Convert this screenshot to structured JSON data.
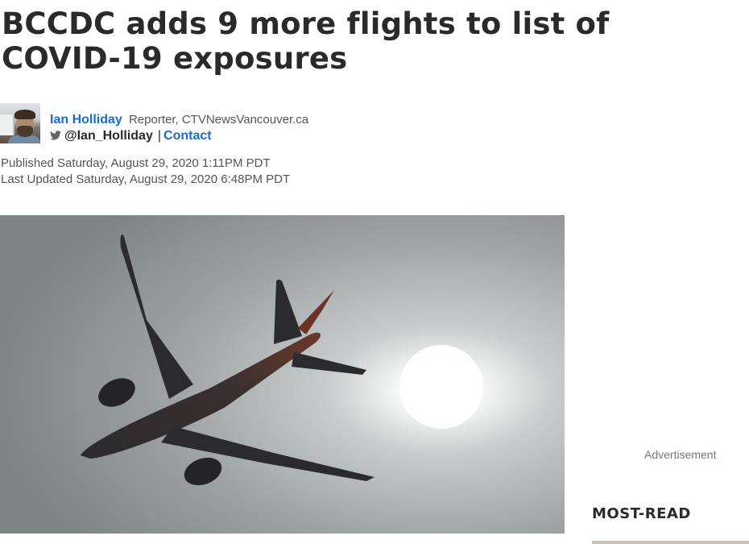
{
  "article": {
    "headline": "BCCDC adds 9 more flights to list of COVID-19 exposures",
    "author": {
      "name": "Ian Holliday",
      "role": "Reporter, CTVNewsVancouver.ca",
      "twitter_handle": "@Ian_Holliday",
      "separator": "|",
      "contact_label": "Contact",
      "avatar_icon": "author-photo"
    },
    "published": "Published Saturday, August 29, 2020 1:11PM PDT",
    "updated": "Last Updated Saturday, August 29, 2020 6:48PM PDT",
    "hero_image": "airplane-silhouette-photo"
  },
  "sidebar": {
    "ad_label": "Advertisement",
    "most_read_title": "MOST-READ"
  },
  "colors": {
    "link": "#1a6ccc",
    "headline": "#2a2a2a"
  }
}
